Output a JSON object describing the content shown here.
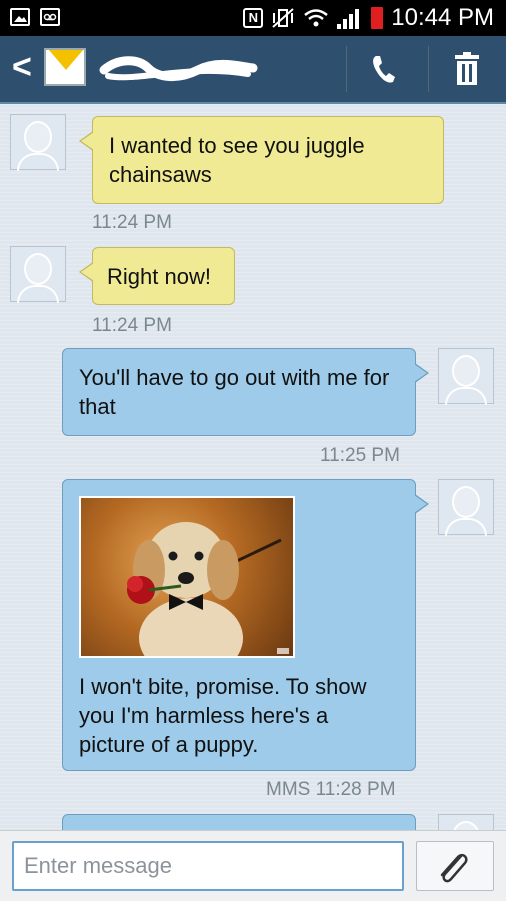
{
  "status_bar": {
    "time": "10:44 PM",
    "icons": [
      "image-icon",
      "voicemail-icon",
      "nfc-icon",
      "vibrate-icon",
      "wifi-icon",
      "signal-icon",
      "battery-low-icon"
    ],
    "colors": {
      "battery": "#e02020"
    }
  },
  "header": {
    "back_glyph": "<",
    "contact_name": "",
    "icons": [
      "envelope-icon",
      "phone-icon",
      "trash-icon"
    ]
  },
  "messages": [
    {
      "direction": "incoming",
      "text": "I wanted to see you juggle chainsaws",
      "time": "11:24 PM"
    },
    {
      "direction": "incoming",
      "text": "Right now!",
      "time": "11:24 PM"
    },
    {
      "direction": "outgoing",
      "text": "You'll have to go out with me for that",
      "time": "11:25 PM"
    },
    {
      "direction": "outgoing",
      "type": "mms",
      "text": "I won't bite, promise. To show you I'm harmless here's a picture of a puppy.",
      "time": "MMS 11:28 PM"
    }
  ],
  "composer": {
    "placeholder": "Enter message",
    "value": "",
    "attach_icon": "paperclip-icon"
  },
  "colors": {
    "incoming_bubble": "#f0ea94",
    "outgoing_bubble": "#9dcbe9",
    "header_bg": "#2f4f6e"
  }
}
